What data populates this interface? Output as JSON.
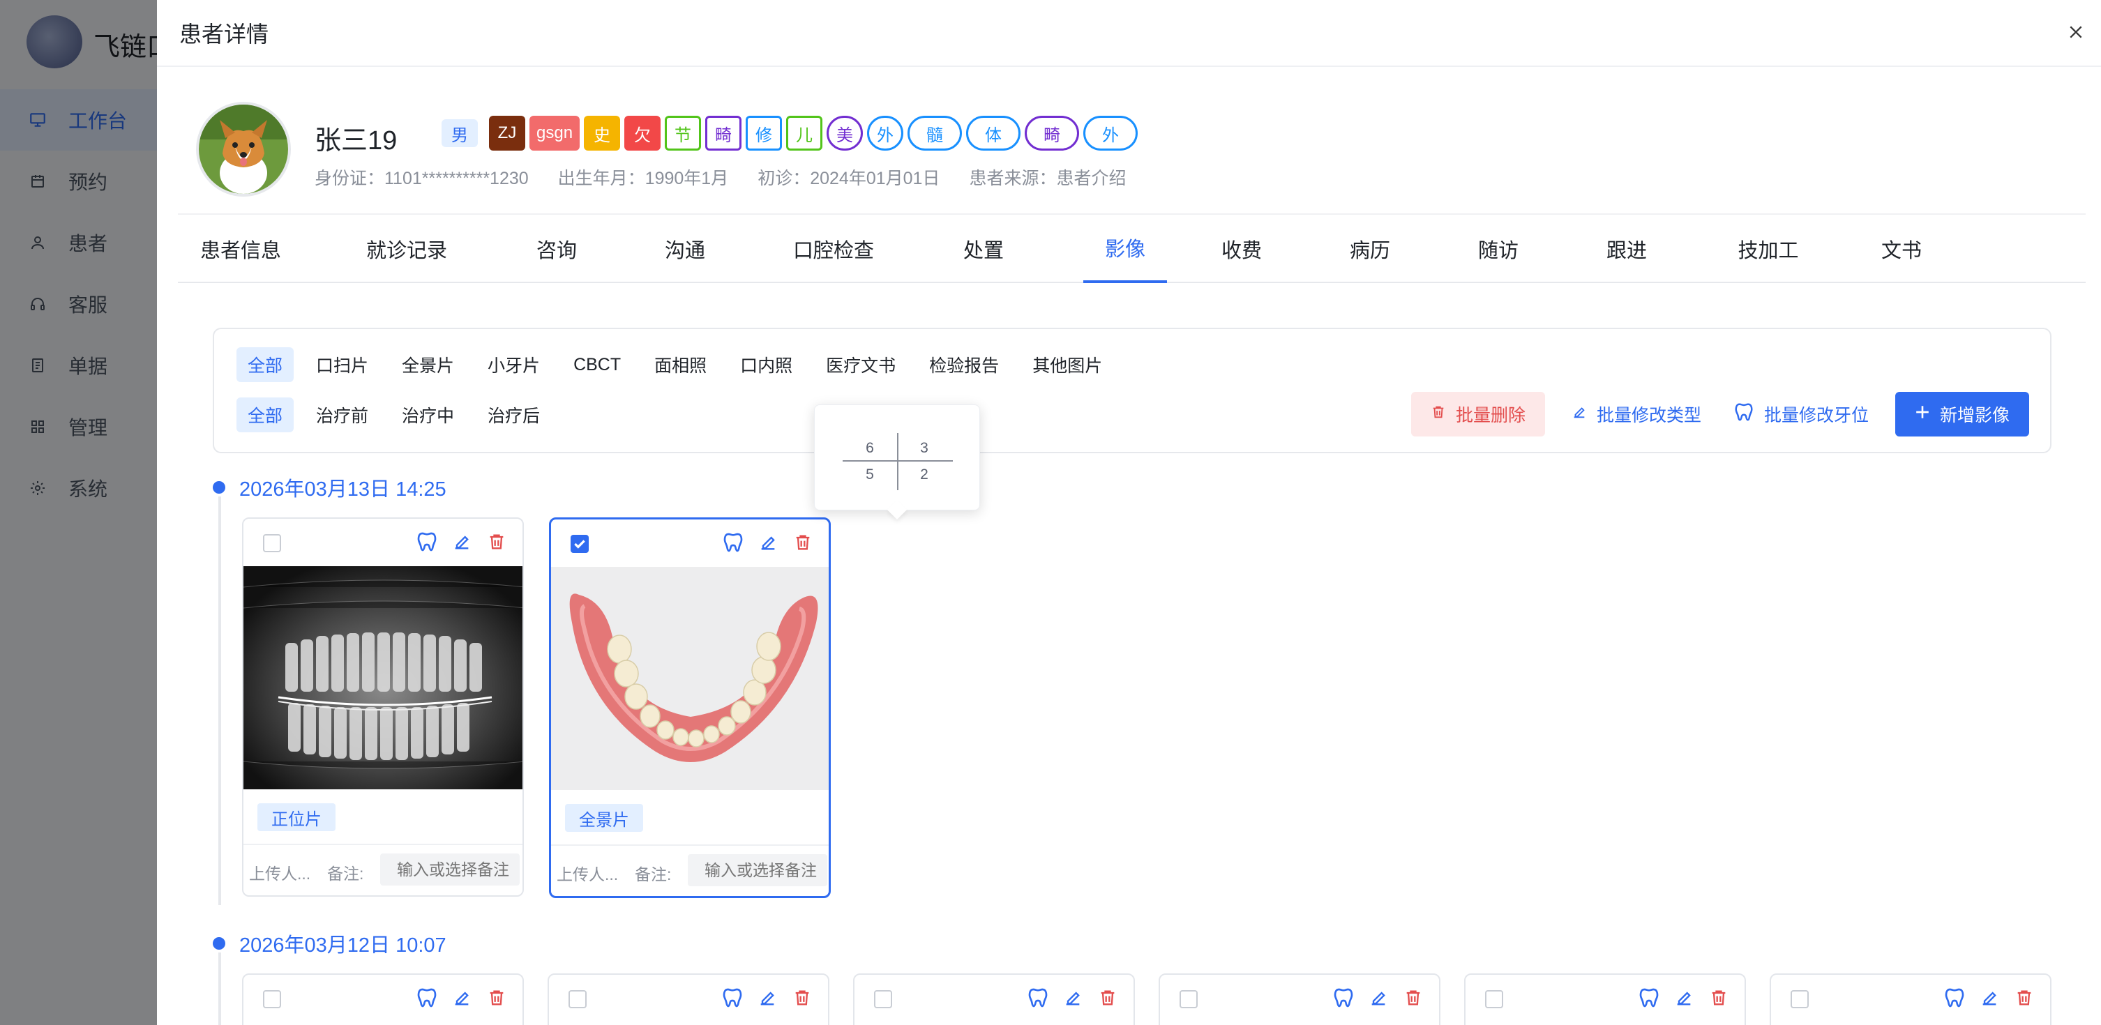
{
  "app": {
    "brand": "飞链口",
    "menu": [
      {
        "label": "工作台",
        "icon": "monitor-icon",
        "active": true
      },
      {
        "label": "预约",
        "icon": "calendar-icon",
        "active": false
      },
      {
        "label": "患者",
        "icon": "user-icon",
        "active": false
      },
      {
        "label": "客服",
        "icon": "headset-icon",
        "active": false
      },
      {
        "label": "单据",
        "icon": "document-icon",
        "active": false
      },
      {
        "label": "管理",
        "icon": "grid-icon",
        "active": false
      },
      {
        "label": "系统",
        "icon": "gear-icon",
        "active": false
      }
    ]
  },
  "drawer": {
    "title": "患者详情",
    "close_icon": "close-icon"
  },
  "patient": {
    "name": "张三19",
    "gender": "男",
    "tags": [
      {
        "text": "ZJ",
        "style": "solid",
        "color": "#7a2e0e"
      },
      {
        "text": "gsgn",
        "style": "solid",
        "color": "#f26b6b"
      },
      {
        "text": "史",
        "style": "solid",
        "color": "#f5b400"
      },
      {
        "text": "欠",
        "style": "solid",
        "color": "#f24848"
      },
      {
        "text": "节",
        "style": "square",
        "color": "#52c41a"
      },
      {
        "text": "畸",
        "style": "square",
        "color": "#722ed1"
      },
      {
        "text": "修",
        "style": "square",
        "color": "#1890ff"
      },
      {
        "text": "儿",
        "style": "square",
        "color": "#52c41a"
      },
      {
        "text": "美",
        "style": "round",
        "color": "#722ed1"
      },
      {
        "text": "外",
        "style": "round",
        "color": "#1890ff"
      },
      {
        "text": "髓",
        "style": "round",
        "color": "#1890ff"
      },
      {
        "text": "体",
        "style": "round",
        "color": "#1890ff"
      },
      {
        "text": "畸",
        "style": "round",
        "color": "#722ed1"
      },
      {
        "text": "外",
        "style": "round",
        "color": "#1890ff"
      }
    ],
    "id_card": "身份证：1101**********1230",
    "birth": "出生年月：1990年1月",
    "first_visit": "初诊：2024年01月01日",
    "source": "患者来源：患者介绍"
  },
  "tabs": [
    {
      "label": "患者信息",
      "active": false
    },
    {
      "label": "就诊记录",
      "active": false
    },
    {
      "label": "咨询",
      "active": false
    },
    {
      "label": "沟通",
      "active": false
    },
    {
      "label": "口腔检查",
      "active": false
    },
    {
      "label": "处置",
      "active": false
    },
    {
      "label": "影像",
      "active": true
    },
    {
      "label": "收费",
      "active": false
    },
    {
      "label": "病历",
      "active": false
    },
    {
      "label": "随访",
      "active": false
    },
    {
      "label": "跟进",
      "active": false
    },
    {
      "label": "技加工",
      "active": false
    },
    {
      "label": "文书",
      "active": false
    }
  ],
  "filters": {
    "types": [
      "全部",
      "口扫片",
      "全景片",
      "小牙片",
      "CBCT",
      "面相照",
      "口内照",
      "医疗文书",
      "检验报告",
      "其他图片"
    ],
    "type_active": "全部",
    "stages": [
      "全部",
      "治疗前",
      "治疗中",
      "治疗后"
    ],
    "stage_active": "全部"
  },
  "actions": {
    "batch_delete": "批量删除",
    "batch_change_type": "批量修改类型",
    "batch_change_tooth": "批量修改牙位",
    "add_image": "新增影像"
  },
  "tooth_popover": {
    "upper_left": "6",
    "upper_right": "3",
    "lower_left": "5",
    "lower_right": "2"
  },
  "groups": [
    {
      "date": "2026年03月13日 14:25",
      "cards": [
        {
          "checked": false,
          "image": "panoramic-xray",
          "type": "正位片",
          "uploader": "上传人...",
          "remark_label": "备注:",
          "remark_placeholder": "输入或选择备注"
        },
        {
          "checked": true,
          "image": "denture-model",
          "type": "全景片",
          "uploader": "上传人...",
          "remark_label": "备注:",
          "remark_placeholder": "输入或选择备注"
        }
      ]
    },
    {
      "date": "2026年03月12日 10:07",
      "cards": [
        {
          "checked": false
        },
        {
          "checked": false
        },
        {
          "checked": false
        },
        {
          "checked": false
        },
        {
          "checked": false
        },
        {
          "checked": false
        }
      ]
    }
  ],
  "colors": {
    "accent": "#2f6bf0",
    "danger": "#e34d4d",
    "selected_tab": "#2f6bf0"
  }
}
